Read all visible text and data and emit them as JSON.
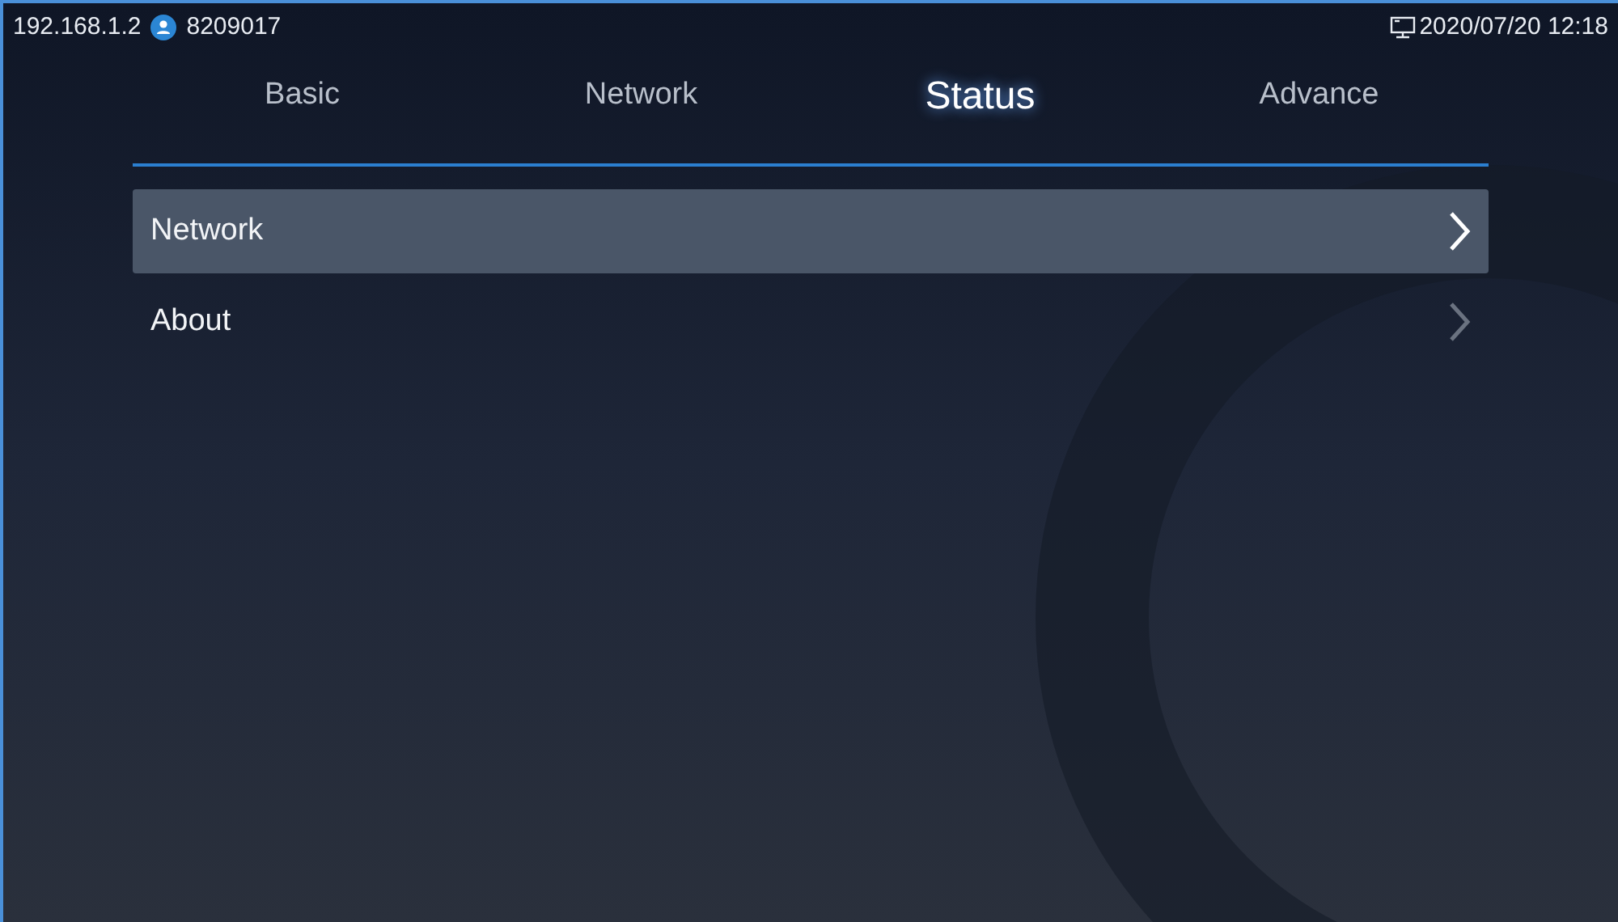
{
  "status_bar": {
    "ip": "192.168.1.2",
    "account": "8209017",
    "datetime": "2020/07/20 12:18"
  },
  "tabs": [
    {
      "label": "Basic",
      "selected": false
    },
    {
      "label": "Network",
      "selected": false
    },
    {
      "label": "Status",
      "selected": true
    },
    {
      "label": "Advance",
      "selected": false
    }
  ],
  "menu": [
    {
      "label": "Network",
      "selected": true
    },
    {
      "label": "About",
      "selected": false
    }
  ]
}
